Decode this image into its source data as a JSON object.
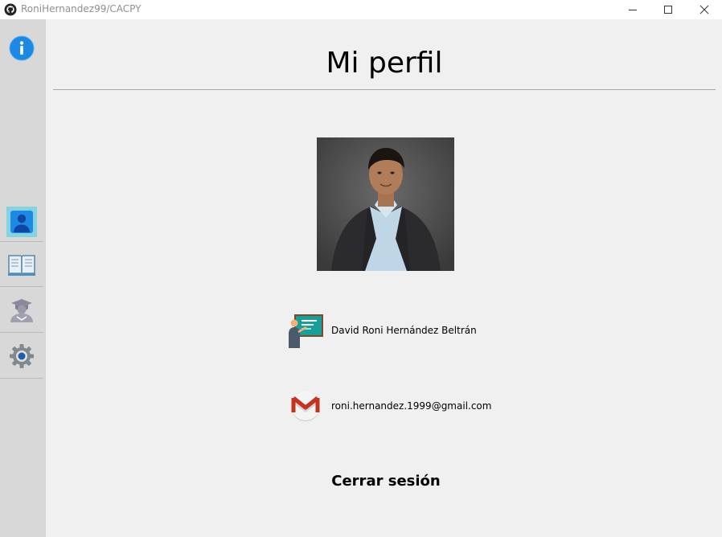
{
  "window": {
    "title": "RoniHernandez99/CACPY",
    "app_icon": "github-icon",
    "controls": [
      "minimize-icon",
      "maximize-icon",
      "close-icon"
    ]
  },
  "sidebar": {
    "info_icon": "info-icon",
    "items": [
      {
        "name": "profile",
        "icon": "user-icon",
        "active": true
      },
      {
        "name": "courses",
        "icon": "book-icon",
        "active": false
      },
      {
        "name": "students",
        "icon": "graduate-icon",
        "active": false
      },
      {
        "name": "settings",
        "icon": "gear-icon",
        "active": false
      }
    ]
  },
  "main": {
    "title": "Mi perfil",
    "user_name": "David Roni Hernández Beltrán",
    "user_email": "roni.hernandez.1999@gmail.com",
    "logout_label": "Cerrar sesión"
  },
  "colors": {
    "sidebar_bg": "#d8d8d8",
    "active_item_bg": "#86d3e0",
    "info_blue": "#1e88e5",
    "background": "#f0f0f0"
  }
}
